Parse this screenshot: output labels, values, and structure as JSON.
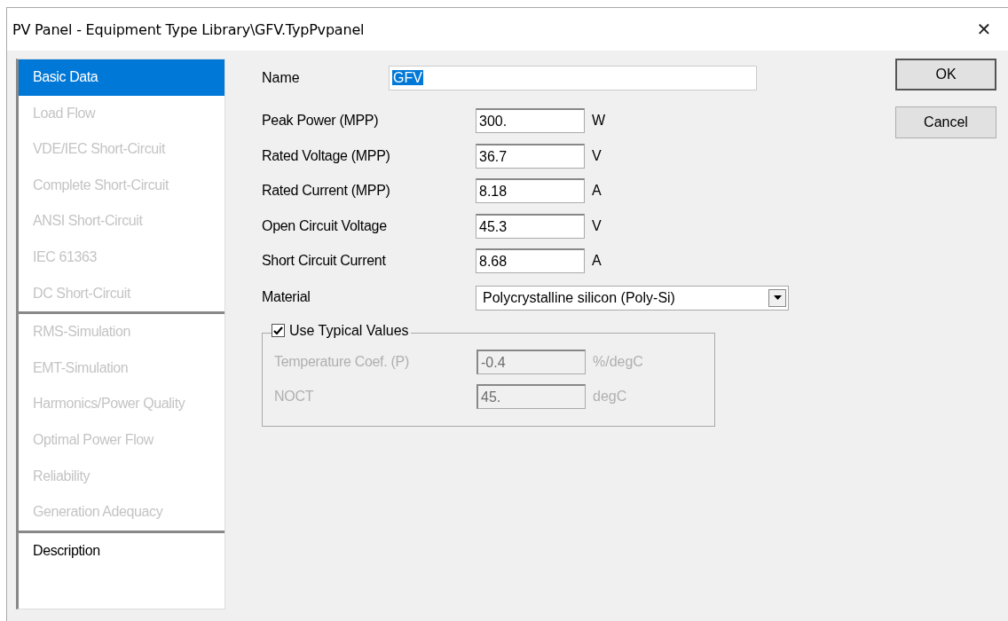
{
  "window": {
    "title": "PV Panel - Equipment Type Library\\GFV.TypPvpanel",
    "close_symbol": "✕"
  },
  "sidebar": {
    "groups": [
      {
        "items": [
          {
            "label": "Basic Data",
            "selected": true,
            "disabled": false
          },
          {
            "label": "Load Flow",
            "selected": false,
            "disabled": true
          },
          {
            "label": "VDE/IEC Short-Circuit",
            "selected": false,
            "disabled": true
          },
          {
            "label": "Complete Short-Circuit",
            "selected": false,
            "disabled": true
          },
          {
            "label": "ANSI Short-Circuit",
            "selected": false,
            "disabled": true
          },
          {
            "label": "IEC 61363",
            "selected": false,
            "disabled": true
          },
          {
            "label": "DC Short-Circuit",
            "selected": false,
            "disabled": true
          }
        ]
      },
      {
        "items": [
          {
            "label": "RMS-Simulation",
            "selected": false,
            "disabled": true
          },
          {
            "label": "EMT-Simulation",
            "selected": false,
            "disabled": true
          },
          {
            "label": "Harmonics/Power Quality",
            "selected": false,
            "disabled": true
          },
          {
            "label": "Optimal Power Flow",
            "selected": false,
            "disabled": true
          },
          {
            "label": "Reliability",
            "selected": false,
            "disabled": true
          },
          {
            "label": "Generation Adequacy",
            "selected": false,
            "disabled": true
          }
        ]
      },
      {
        "items": [
          {
            "label": "Description",
            "selected": false,
            "disabled": false
          }
        ]
      }
    ]
  },
  "name_field": {
    "label": "Name",
    "value": "GFV",
    "highlighted": true
  },
  "fields": [
    {
      "kind": "text",
      "label": "Peak Power (MPP)",
      "value": "300.",
      "unit": "W"
    },
    {
      "kind": "text",
      "label": "Rated Voltage (MPP)",
      "value": "36.7",
      "unit": "V"
    },
    {
      "kind": "text",
      "label": "Rated Current (MPP)",
      "value": "8.18",
      "unit": "A"
    },
    {
      "kind": "text",
      "label": "Open Circuit Voltage",
      "value": "45.3",
      "unit": "V"
    },
    {
      "kind": "text",
      "label": "Short Circuit Current",
      "value": "8.68",
      "unit": "A"
    },
    {
      "kind": "select",
      "label": "Material",
      "value": "Polycrystalline silicon (Poly-Si)"
    }
  ],
  "typical_group": {
    "label": "Use Typical Values",
    "checked": true,
    "fields": [
      {
        "label": "Temperature Coef. (P)",
        "value": "-0.4",
        "unit": "%/degC",
        "disabled": true
      },
      {
        "label": "NOCT",
        "value": "45.",
        "unit": "degC",
        "disabled": true
      }
    ]
  },
  "buttons": [
    {
      "label": "OK",
      "default": true
    },
    {
      "label": "Cancel",
      "default": false
    }
  ]
}
